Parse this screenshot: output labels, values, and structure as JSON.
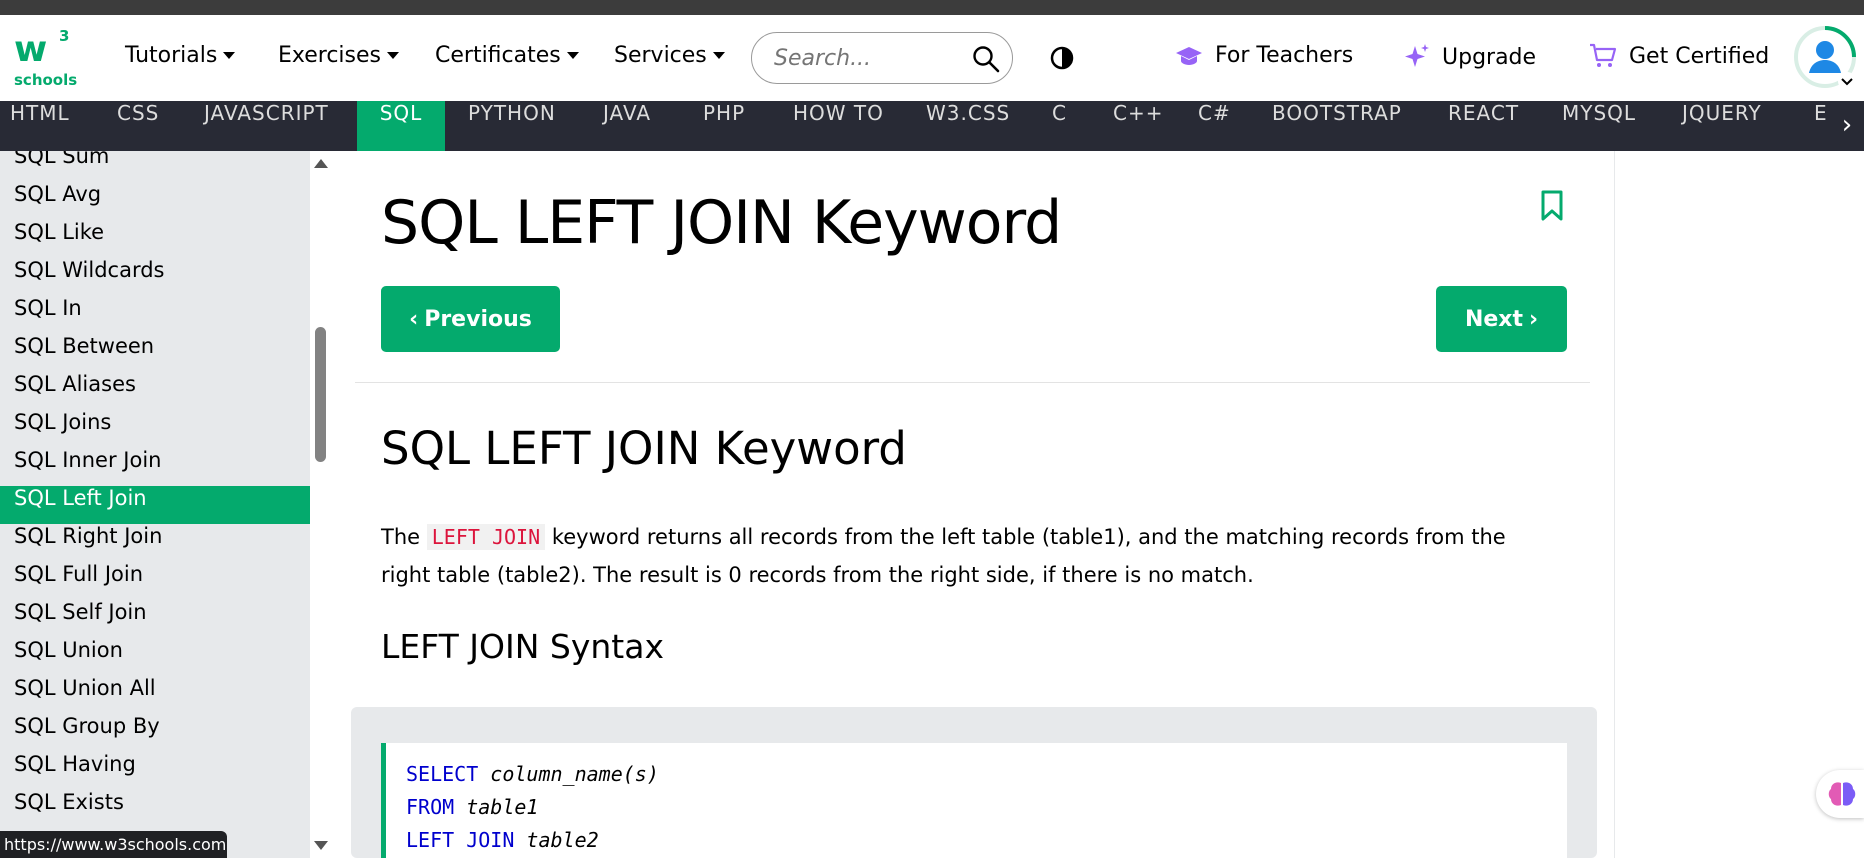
{
  "nav": {
    "menus": [
      "Tutorials",
      "Exercises",
      "Certificates",
      "Services"
    ],
    "search_placeholder": "Search...",
    "for_teachers": "For Teachers",
    "upgrade": "Upgrade",
    "get_certified": "Get Certified"
  },
  "langbar": {
    "items": [
      "HTML",
      "CSS",
      "JAVASCRIPT",
      "SQL",
      "PYTHON",
      "JAVA",
      "PHP",
      "HOW TO",
      "W3.CSS",
      "C",
      "C++",
      "C#",
      "BOOTSTRAP",
      "REACT",
      "MYSQL",
      "JQUERY",
      "E"
    ],
    "active": "SQL"
  },
  "sidebar": {
    "items": [
      "SQL Sum",
      "SQL Avg",
      "SQL Like",
      "SQL Wildcards",
      "SQL In",
      "SQL Between",
      "SQL Aliases",
      "SQL Joins",
      "SQL Inner Join",
      "SQL Left Join",
      "SQL Right Join",
      "SQL Full Join",
      "SQL Self Join",
      "SQL Union",
      "SQL Union All",
      "SQL Group By",
      "SQL Having",
      "SQL Exists"
    ],
    "active": "SQL Left Join"
  },
  "main": {
    "title": "SQL LEFT JOIN Keyword",
    "prev_label": "Previous",
    "next_label": "Next",
    "section_title": "SQL LEFT JOIN Keyword",
    "para_before": "The",
    "para_code": "LEFT JOIN",
    "para_after": "keyword returns all records from the left table (table1), and the matching records from the right table (table2). The result is 0 records from the right side, if there is no match.",
    "syntax_title": "LEFT JOIN Syntax",
    "code_lines": [
      {
        "kw": "SELECT",
        "rest": "column_name(s)"
      },
      {
        "kw": "FROM",
        "rest": "table1"
      },
      {
        "kw": "LEFT JOIN",
        "rest": "table2"
      }
    ]
  },
  "status_url": "https://www.w3schools.com",
  "colors": {
    "brand": "#04aa6d",
    "navbar": "#282a35",
    "sidebar": "#e7e9eb",
    "code_inline": "#dc143c",
    "keyword": "#0000cd"
  }
}
